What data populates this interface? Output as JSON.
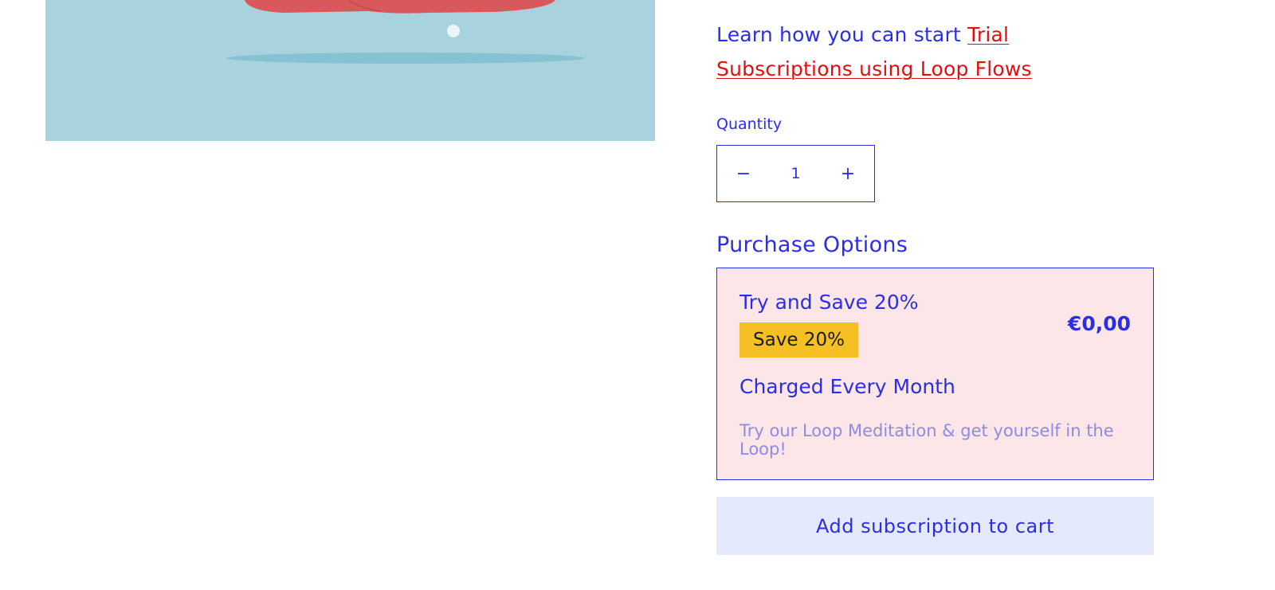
{
  "learn": {
    "prefix": "Learn how you can start ",
    "link_text": "Trial Subscriptions using Loop Flows"
  },
  "quantity": {
    "label": "Quantity",
    "minus": "−",
    "value": "1",
    "plus": "+"
  },
  "purchase_options": {
    "title": "Purchase Options",
    "option": {
      "name": "Try and Save 20%",
      "badge": "Save 20%",
      "price": "€0,00",
      "frequency": "Charged Every Month",
      "description": "Try our Loop Meditation & get yourself in the Loop!"
    }
  },
  "cart": {
    "add_label": "Add subscription to cart"
  },
  "colors": {
    "primary": "#2b2ee8",
    "link": "#e01010",
    "image_bg": "#a8d3de",
    "option_bg": "#fde6e8",
    "badge_bg": "#f6c024",
    "button_bg": "#e4e9fd",
    "description": "#8f89e8"
  }
}
